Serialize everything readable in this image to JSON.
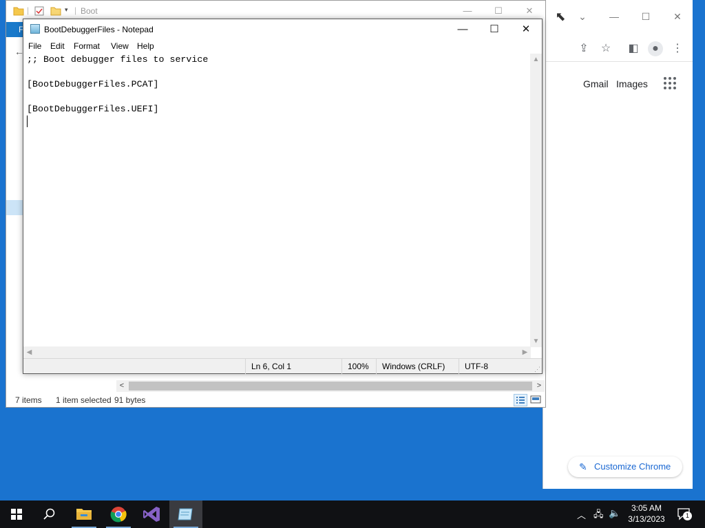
{
  "explorer": {
    "title": "Boot",
    "ribbon_tab": "F",
    "status": {
      "items_count": "7 items",
      "selected": "1 item selected",
      "size": "91 bytes"
    }
  },
  "notepad": {
    "title": "BootDebuggerFiles - Notepad",
    "menu": [
      "File",
      "Edit",
      "Format",
      "View",
      "Help"
    ],
    "lines": [
      ";; Boot debugger files to service",
      "",
      "[BootDebuggerFiles.PCAT]",
      "",
      "[BootDebuggerFiles.UEFI]",
      ""
    ],
    "status": {
      "position": "Ln 6, Col 1",
      "zoom": "100%",
      "line_ending": "Windows (CRLF)",
      "encoding": "UTF-8"
    }
  },
  "chrome": {
    "gmail_label": "Gmail",
    "images_label": "Images",
    "customize_label": "Customize Chrome"
  },
  "taskbar": {
    "time": "3:05 AM",
    "date": "3/13/2023",
    "notification_count": "1"
  },
  "colors": {
    "desktop": "#1a73cf",
    "taskbar": "#101114",
    "chrome_accent": "#1967d2"
  }
}
